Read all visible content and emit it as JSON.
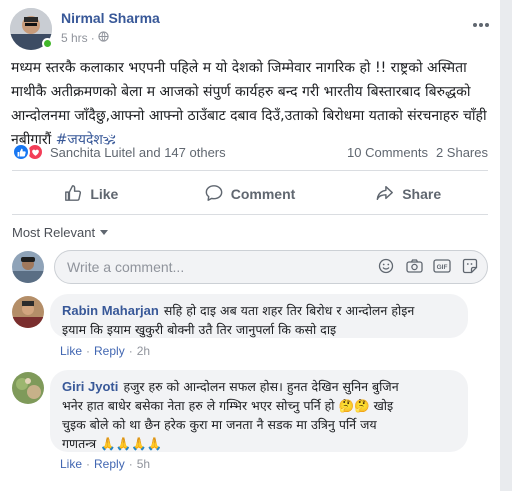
{
  "post": {
    "author": "Nirmal Sharma",
    "time": "5 hrs",
    "privacy_icon": "globe-icon",
    "text": "मध्यम स्तरकै कलाकार भएपनी पहिले म यो देशको जिम्मेवार नागरिक हो !! राष्ट्रको अस्मिता माथीकै अतीक्रमणको बेला म आजको संपुर्ण कार्यहरु बन्द गरी भारतीय बिस्तारबाद बिरुद्धको आन्दोलनमा जाँदैछु,आफ्नो आफ्नो ठाउँबाट दबाव दिउँ,उताको बिरोधमा यताको संरचनाहरु चाँही नबीगारौं",
    "hashtag": "#जयदेश🕉"
  },
  "reactions": {
    "summary": "Sanchita Luitel and 147 others",
    "comments_count": "10 Comments",
    "shares_count": "2 Shares"
  },
  "actions": {
    "like": "Like",
    "comment": "Comment",
    "share": "Share"
  },
  "sort": {
    "label": "Most Relevant"
  },
  "composer": {
    "placeholder": "Write a comment..."
  },
  "comments": [
    {
      "author": "Rabin Maharjan",
      "text_line1": "सहि हो दाइ अब यता शहर तिर बिरोध र आन्दोलन होइन",
      "text_line2": "इयाम कि इयाम खुकुरी बोक्नी उतै तिर जानुपर्ला कि कसो दाइ",
      "like": "Like",
      "reply": "Reply",
      "time": "2h"
    },
    {
      "author": "Giri Jyoti",
      "text_line1": "हजुर हरु को आन्दोलन सफल होस। हुनत देखिन सुनिन बुजिन",
      "text_line2": "भनेर हात बाधेर बसेका नेता हरु ले गम्भिर भएर सोच्नु पर्नि हो 🤔🤔 खोइ",
      "text_line3": "चुइक बोले को था छैन हरेक कुरा मा जनता नै सडक मा उत्रिनु पर्नि जय",
      "text_line4": "गणतन्त्र 🙏🙏🙏🙏",
      "like": "Like",
      "reply": "Reply",
      "time": "5h"
    }
  ],
  "colors": {
    "link": "#385898",
    "like_blue": "#1877f2",
    "love_red": "#f33e58",
    "online_green": "#42b72a"
  }
}
